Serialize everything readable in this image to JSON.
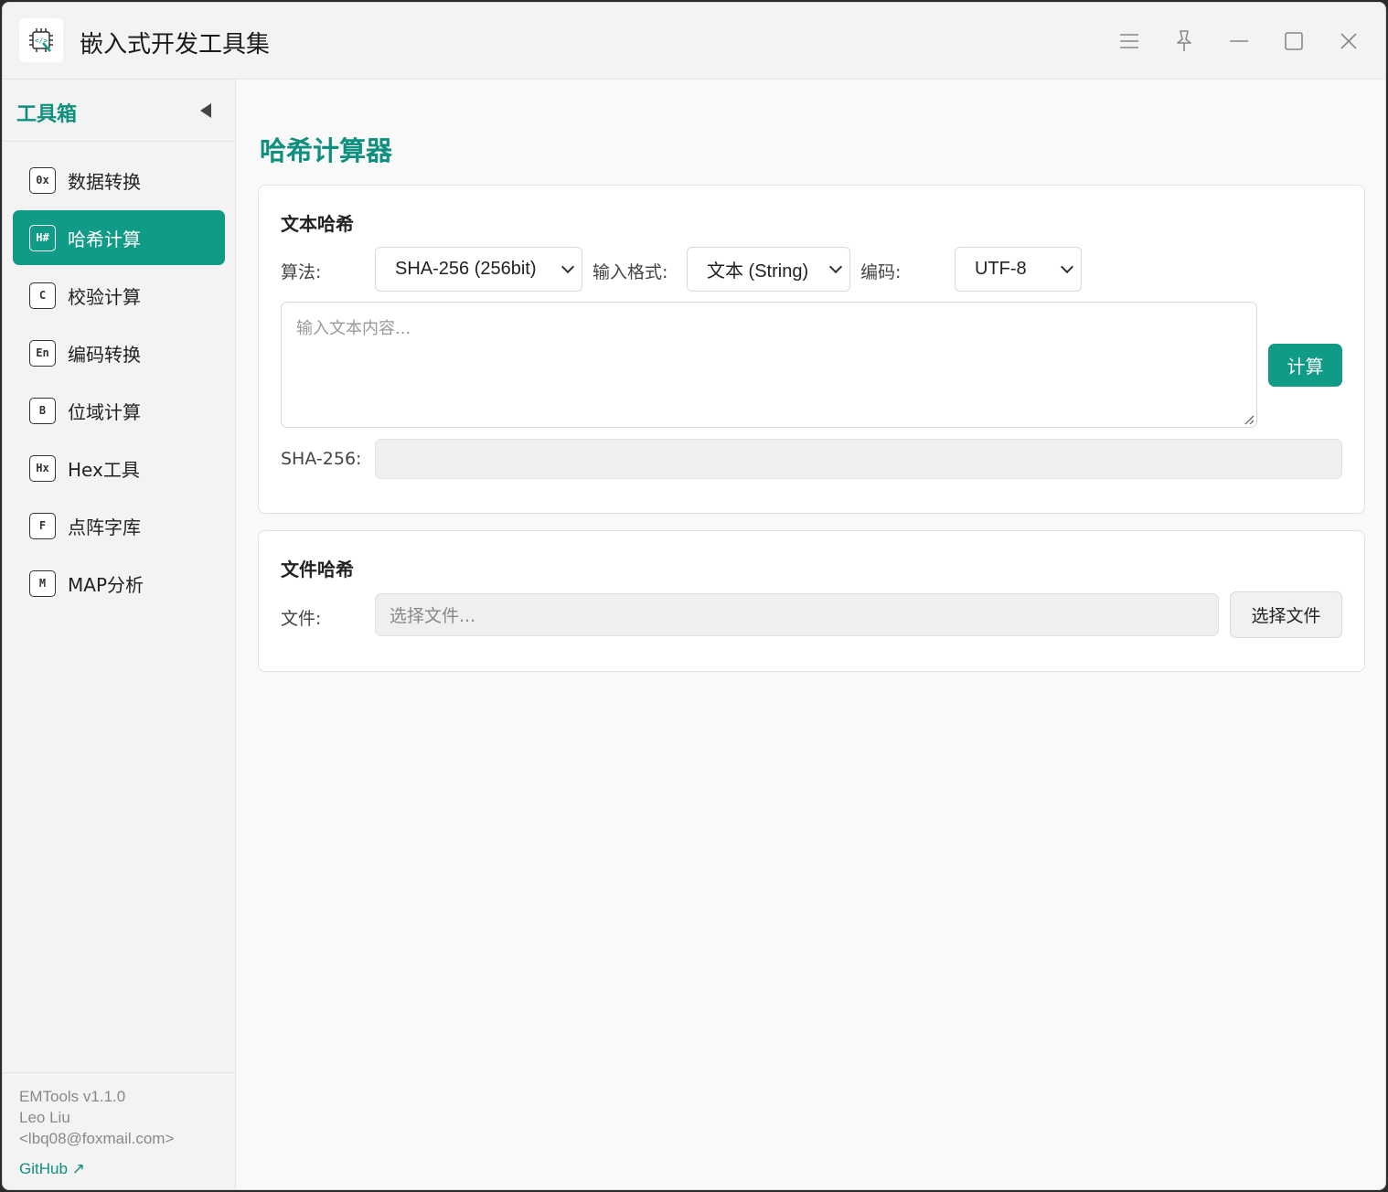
{
  "window": {
    "title": "嵌入式开发工具集"
  },
  "sidebar": {
    "title": "工具箱",
    "items": [
      {
        "badge": "0x",
        "label": "数据转换",
        "active": false
      },
      {
        "badge": "H#",
        "label": "哈希计算",
        "active": true
      },
      {
        "badge": "C",
        "label": "校验计算",
        "active": false
      },
      {
        "badge": "En",
        "label": "编码转换",
        "active": false
      },
      {
        "badge": "B",
        "label": "位域计算",
        "active": false
      },
      {
        "badge": "Hx",
        "label": "Hex工具",
        "active": false
      },
      {
        "badge": "F",
        "label": "点阵字库",
        "active": false
      },
      {
        "badge": "M",
        "label": "MAP分析",
        "active": false
      }
    ],
    "footer": {
      "version": "EMTools v1.1.0",
      "author": "Leo Liu",
      "email": "<lbq08@foxmail.com>",
      "link": "GitHub ↗"
    }
  },
  "page": {
    "title": "哈希计算器",
    "text_hash": {
      "title": "文本哈希",
      "algorithm_label": "算法:",
      "algorithm_value": "SHA-256 (256bit)",
      "format_label": "输入格式:",
      "format_value": "文本 (String)",
      "encoding_label": "编码:",
      "encoding_value": "UTF-8",
      "input_placeholder": "输入文本内容...",
      "compute_button": "计算",
      "result_label": "SHA-256:",
      "result_value": ""
    },
    "file_hash": {
      "title": "文件哈希",
      "file_label": "文件:",
      "file_placeholder": "选择文件...",
      "choose_button": "选择文件"
    }
  },
  "colors": {
    "accent": "#0f9b86",
    "accent_text": "#0f8f7e"
  },
  "icons": [
    "app-logo-icon",
    "menu-icon",
    "pin-icon",
    "minimize-icon",
    "maximize-icon",
    "close-icon",
    "collapse-arrow-icon"
  ]
}
